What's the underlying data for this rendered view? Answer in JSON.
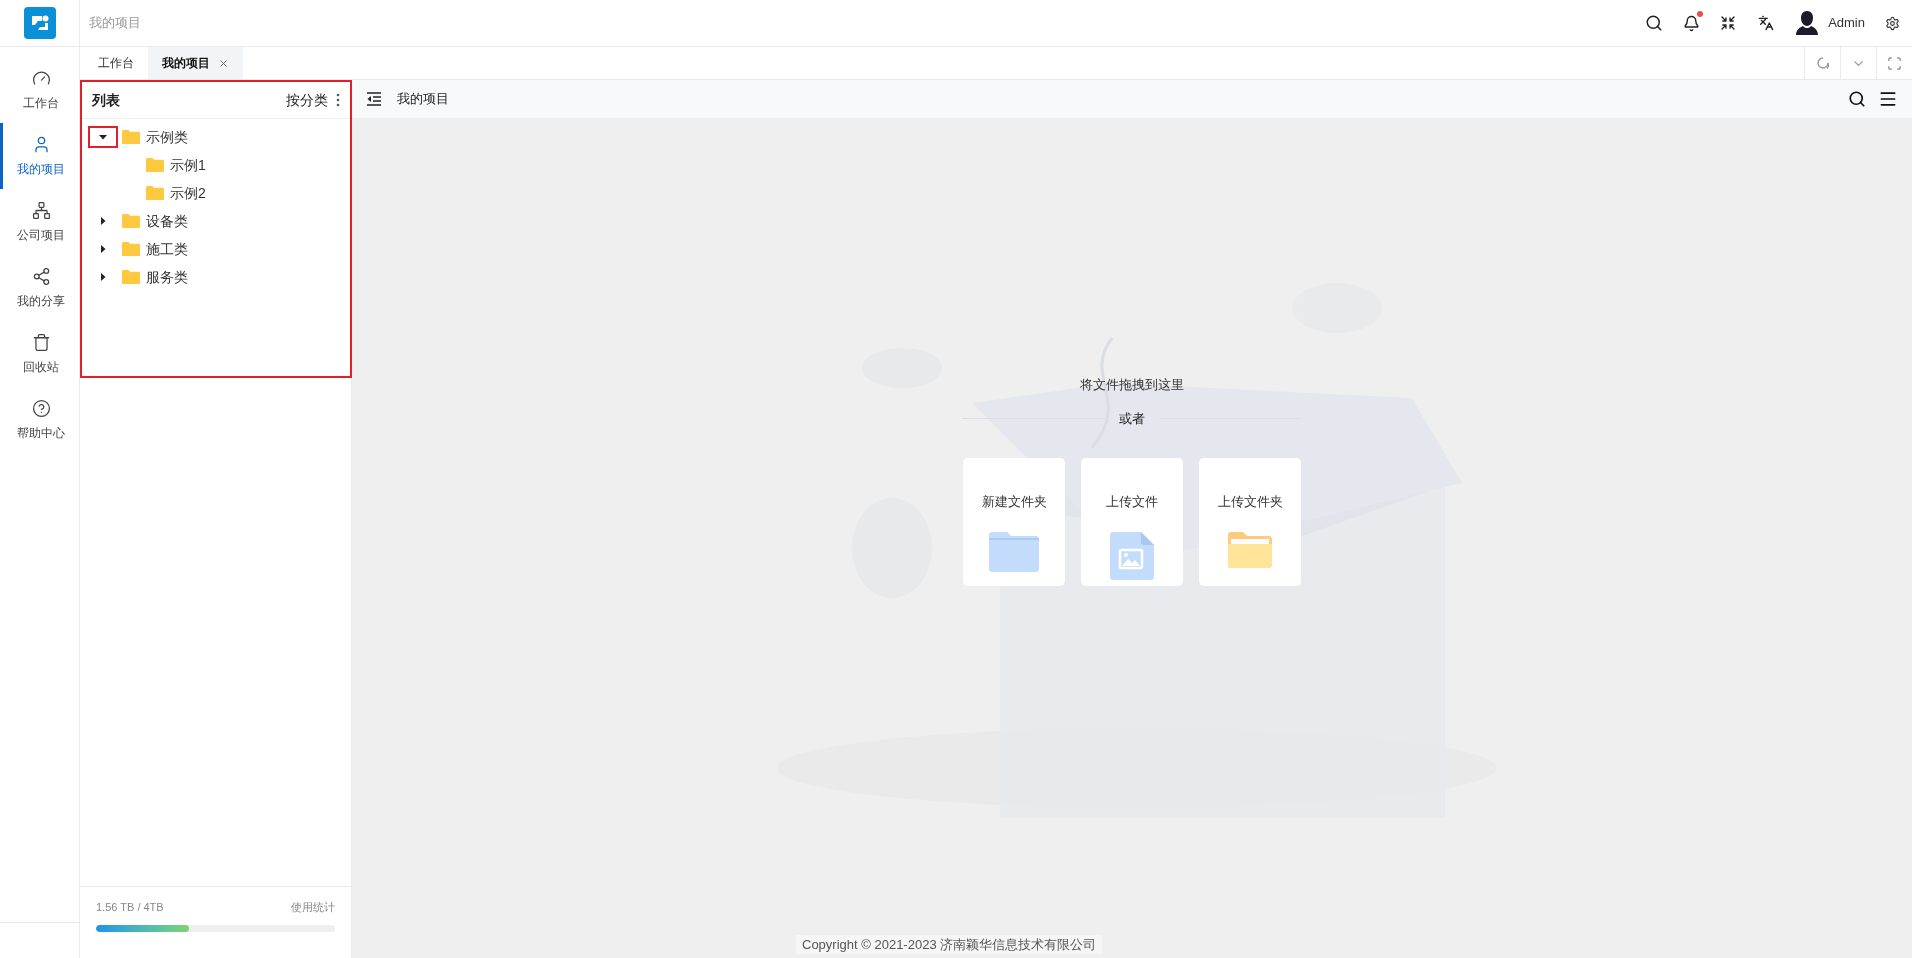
{
  "header": {
    "breadcrumb": "我的项目",
    "notification_badge": true,
    "user": "Admin"
  },
  "nav": [
    {
      "label": "工作台",
      "selected": false
    },
    {
      "label": "我的项目",
      "selected": true
    },
    {
      "label": "公司项目",
      "selected": false
    },
    {
      "label": "我的分享",
      "selected": false
    },
    {
      "label": "回收站",
      "selected": false
    },
    {
      "label": "帮助中心",
      "selected": false
    }
  ],
  "tabs": [
    {
      "label": "工作台",
      "selected": false,
      "closable": false
    },
    {
      "label": "我的项目",
      "selected": true,
      "closable": true
    }
  ],
  "list_panel": {
    "title": "列表",
    "sort": "按分类",
    "highlighted": true,
    "tree": [
      {
        "label": "示例类",
        "expanded": true,
        "toggle_highlighted": true,
        "children": [
          {
            "label": "示例1"
          },
          {
            "label": "示例2"
          }
        ]
      },
      {
        "label": "设备类",
        "expanded": false,
        "toggle_highlighted": false
      },
      {
        "label": "施工类",
        "expanded": false,
        "toggle_highlighted": false
      },
      {
        "label": "服务类",
        "expanded": false,
        "toggle_highlighted": false
      }
    ]
  },
  "storage": {
    "usage": "1.56 TB / 4TB",
    "link": "使用统计",
    "level": 0.39
  },
  "main": {
    "title": "我的项目",
    "drop_hint": "将文件拖拽到这里",
    "or": "或者",
    "actions": [
      {
        "label": "新建文件夹",
        "kind": "new-folder"
      },
      {
        "label": "上传文件",
        "kind": "upload-file"
      },
      {
        "label": "上传文件夹",
        "kind": "upload-folder"
      }
    ]
  },
  "footer": "Copyright © 2021-2023 济南颖华信息技术有限公司"
}
